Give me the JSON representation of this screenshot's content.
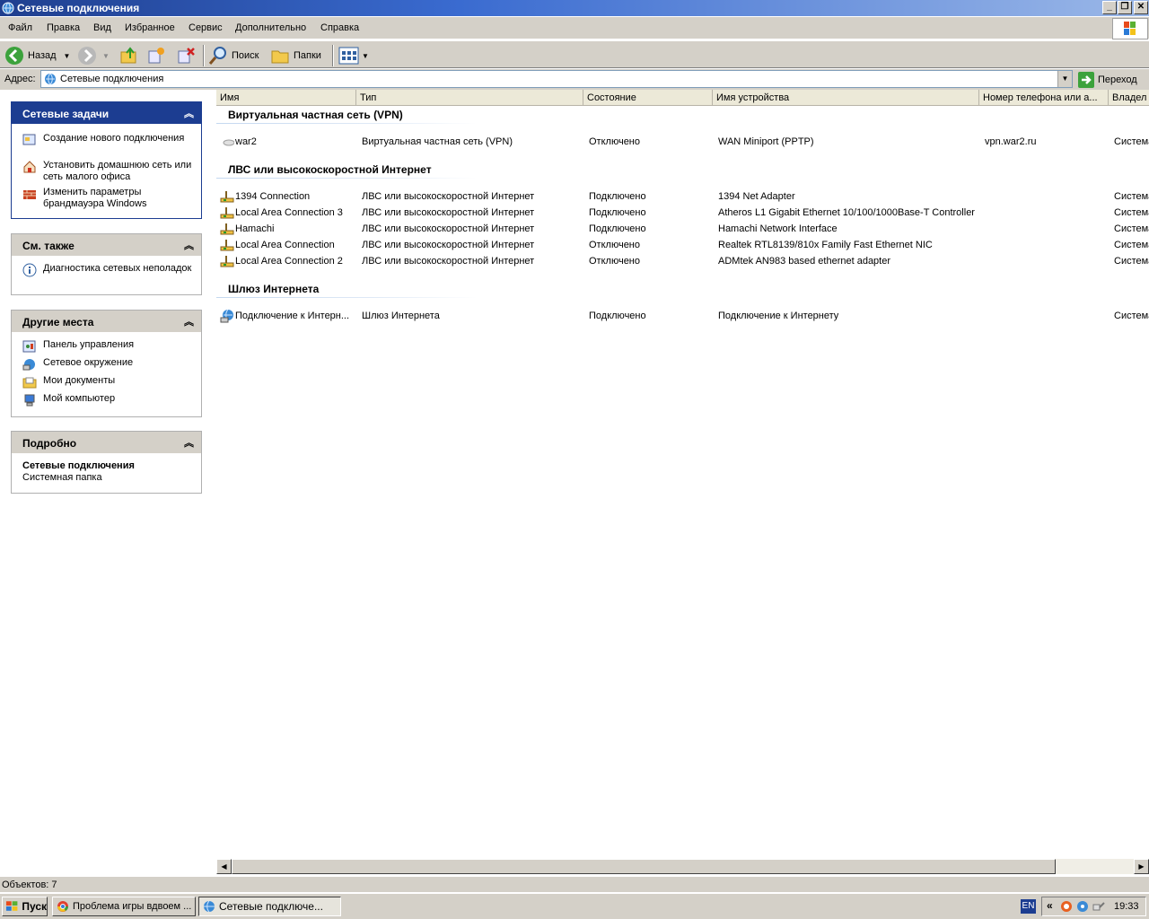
{
  "window": {
    "title": "Сетевые подключения"
  },
  "menu": [
    "Файл",
    "Правка",
    "Вид",
    "Избранное",
    "Сервис",
    "Дополнительно",
    "Справка"
  ],
  "toolbar": {
    "back_label": "Назад",
    "search_label": "Поиск",
    "folders_label": "Папки"
  },
  "address": {
    "label": "Адрес:",
    "value": "Сетевые подключения",
    "go_label": "Переход"
  },
  "panels": {
    "network_tasks": {
      "title": "Сетевые задачи",
      "items": [
        "Создание нового подключения",
        "Установить домашнюю сеть или сеть малого офиса",
        "Изменить параметры брандмауэра Windows"
      ]
    },
    "see_also": {
      "title": "См. также",
      "items": [
        "Диагностика сетевых неполадок"
      ]
    },
    "other_places": {
      "title": "Другие места",
      "items": [
        "Панель управления",
        "Сетевое окружение",
        "Мои документы",
        "Мой компьютер"
      ]
    },
    "details": {
      "title": "Подробно",
      "name": "Сетевые подключения",
      "desc": "Системная папка"
    }
  },
  "columns": [
    "Имя",
    "Тип",
    "Состояние",
    "Имя устройства",
    "Номер телефона или а...",
    "Владел"
  ],
  "groups": [
    {
      "title": "Виртуальная частная сеть (VPN)",
      "rows": [
        [
          "war2",
          "Виртуальная частная сеть (VPN)",
          "Отключено",
          "WAN Miniport (PPTP)",
          "vpn.war2.ru",
          "Система"
        ]
      ]
    },
    {
      "title": "ЛВС или высокоскоростной Интернет",
      "rows": [
        [
          "1394 Connection",
          "ЛВС или высокоскоростной Интернет",
          "Подключено",
          "1394 Net Adapter",
          "",
          "Система"
        ],
        [
          "Local Area Connection 3",
          "ЛВС или высокоскоростной Интернет",
          "Подключено",
          "Atheros L1 Gigabit Ethernet 10/100/1000Base-T Controller",
          "",
          "Система"
        ],
        [
          "Hamachi",
          "ЛВС или высокоскоростной Интернет",
          "Подключено",
          "Hamachi Network Interface",
          "",
          "Система"
        ],
        [
          "Local Area Connection",
          "ЛВС или высокоскоростной Интернет",
          "Отключено",
          "Realtek RTL8139/810x Family Fast Ethernet NIC",
          "",
          "Система"
        ],
        [
          "Local Area Connection 2",
          "ЛВС или высокоскоростной Интернет",
          "Отключено",
          "ADMtek AN983 based ethernet adapter",
          "",
          "Система"
        ]
      ]
    },
    {
      "title": "Шлюз Интернета",
      "rows": [
        [
          "Подключение к Интерн...",
          "Шлюз Интернета",
          "Подключено",
          "Подключение к Интернету",
          "",
          "Система"
        ]
      ]
    }
  ],
  "status": {
    "text": "Объектов: 7"
  },
  "taskbar": {
    "start_label": "Пуск",
    "buttons": [
      "Проблема игры вдвоем ...",
      "Сетевые подключе..."
    ],
    "lang": "EN",
    "clock": "19:33"
  },
  "colors": {
    "title_bar": "#1f3f8f",
    "panel_header": "#1c3d91",
    "chrome": "#d4d0c8"
  }
}
